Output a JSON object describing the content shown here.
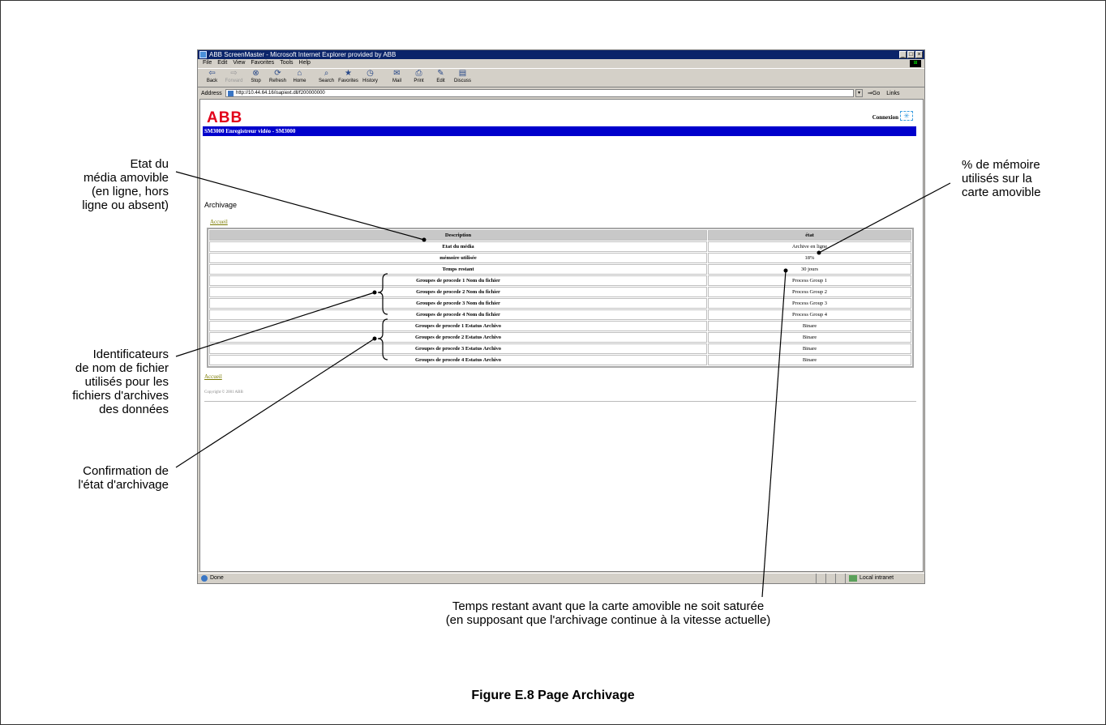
{
  "browser": {
    "title": "ABB ScreenMaster - Microsoft Internet Explorer provided by ABB",
    "menu": [
      "File",
      "Edit",
      "View",
      "Favorites",
      "Tools",
      "Help"
    ],
    "toolbar": [
      {
        "label": "Back",
        "icon": "back-arrow-icon"
      },
      {
        "label": "Forward",
        "icon": "forward-arrow-icon"
      },
      {
        "label": "Stop",
        "icon": "stop-icon"
      },
      {
        "label": "Refresh",
        "icon": "refresh-icon"
      },
      {
        "label": "Home",
        "icon": "home-icon"
      },
      {
        "label": "Search",
        "icon": "search-icon"
      },
      {
        "label": "Favorites",
        "icon": "favorites-icon"
      },
      {
        "label": "History",
        "icon": "history-icon"
      },
      {
        "label": "Mail",
        "icon": "mail-icon"
      },
      {
        "label": "Print",
        "icon": "print-icon"
      },
      {
        "label": "Edit",
        "icon": "edit-icon"
      },
      {
        "label": "Discuss",
        "icon": "discuss-icon"
      }
    ],
    "address_label": "Address",
    "address_value": "http://10.44.64.16/isapiext.dll/f200000000",
    "go_label": "Go",
    "links_label": "Links",
    "status_text": "Done",
    "zone_text": "Local intranet"
  },
  "page": {
    "logo": "ABB",
    "connexion_label": "Connexion",
    "banner": "SM3000 Enregistreur vidéo - SM3000",
    "heading": "Archivage",
    "accueil": "Accueil",
    "copyright": "Copyright © 2001 ABB",
    "table": {
      "headers": [
        "Description",
        "état"
      ],
      "rows": [
        [
          "Etat du média",
          "Archive en ligne"
        ],
        [
          "mémoire utilisée",
          "18%"
        ],
        [
          "Temps restant",
          "30 jours"
        ],
        [
          "Groupes de procede 1 Nom du fichier",
          "Process Group 1"
        ],
        [
          "Groupes de procede 2 Nom du fichier",
          "Process Group 2"
        ],
        [
          "Groupes de procede 3 Nom du fichier",
          "Process Group 3"
        ],
        [
          "Groupes de procede 4 Nom du fichier",
          "Process Group 4"
        ],
        [
          "Groupes de procede 1 Estatus Archivo",
          "Binare"
        ],
        [
          "Groupes de procede 2 Estatus Archivo",
          "Binare"
        ],
        [
          "Groupes de procede 3 Estatus Archivo",
          "Binare"
        ],
        [
          "Groupes de procede 4 Estatus Archivo",
          "Binare"
        ]
      ]
    }
  },
  "annotations": {
    "media_state": [
      "Etat du",
      "média amovible",
      "(en ligne, hors",
      "ligne ou absent)"
    ],
    "memory_pct": [
      "% de mémoire",
      "utilisés sur la",
      "carte amovible"
    ],
    "file_ids": [
      "Identificateurs",
      "de nom de fichier",
      "utilisés pour les",
      "fichiers d'archives",
      "des données"
    ],
    "archive_confirm": [
      "Confirmation de",
      "l'état d'archivage"
    ],
    "time_remaining": [
      "Temps restant avant que la carte amovible ne soit saturée",
      "(en supposant que l'archivage continue à la vitesse actuelle)"
    ]
  },
  "caption": "Figure E.8 Page Archivage"
}
